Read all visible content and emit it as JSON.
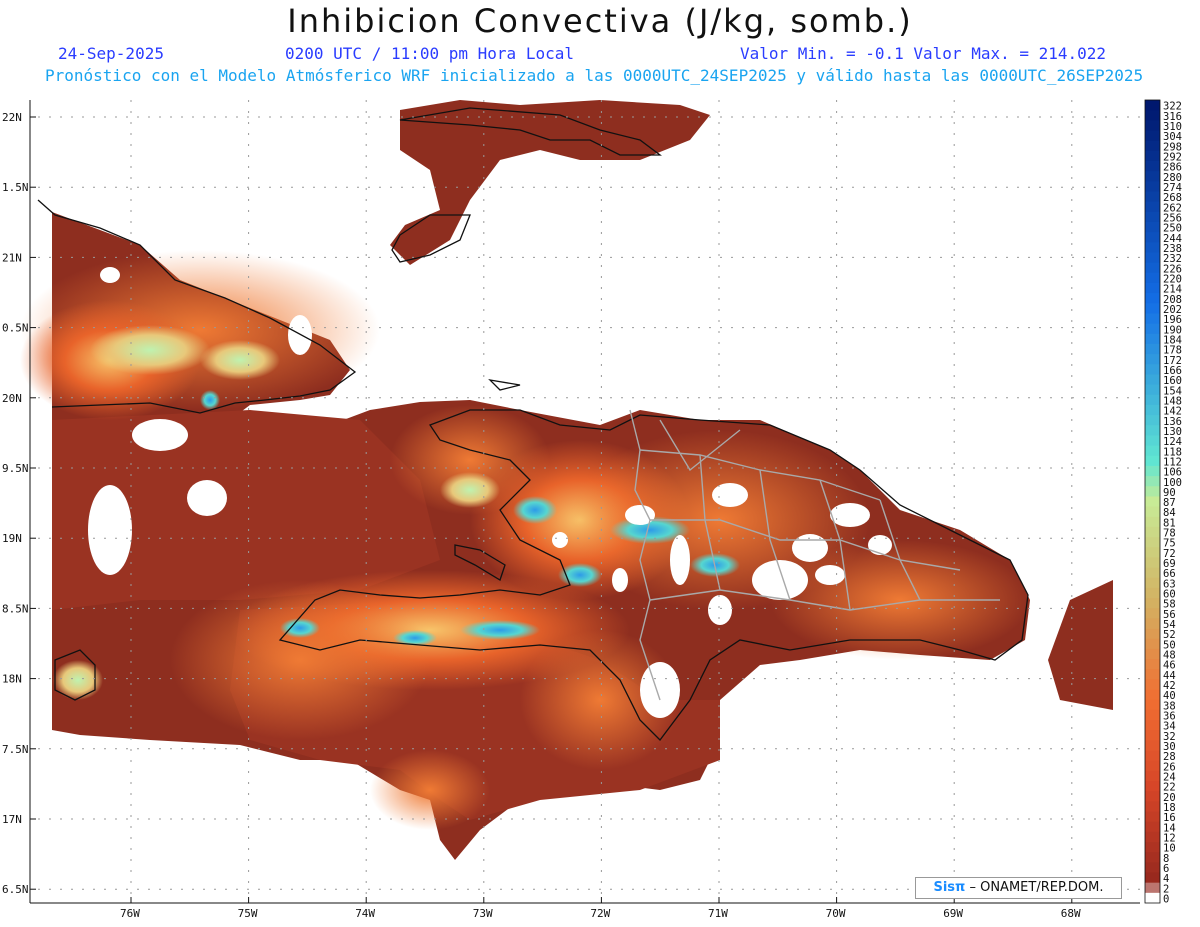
{
  "header": {
    "title": "Inhibicion Convectiva (J/kg, somb.)",
    "date": "24-Sep-2025",
    "time": "0200 UTC / 11:00 pm Hora Local",
    "min_max": "Valor Min. = -0.1  Valor Max. = 214.022",
    "model_line": "Pronóstico con el Modelo Atmósferico WRF inicializado a las 0000UTC_24SEP2025 y válido hasta las  0000UTC_26SEP2025"
  },
  "map": {
    "lat_labels": [
      "22N",
      "1.5N",
      "21N",
      "0.5N",
      "20N",
      "9.5N",
      "19N",
      "8.5N",
      "18N",
      "7.5N",
      "17N",
      "6.5N"
    ],
    "lon_labels": [
      "76W",
      "75W",
      "74W",
      "73W",
      "72W",
      "71W",
      "70W",
      "69W",
      "68W"
    ],
    "ocean_color": "#ffffff",
    "land_low_color": "#8b2a1c"
  },
  "colorbar": {
    "labels": [
      "322",
      "316",
      "310",
      "304",
      "298",
      "292",
      "286",
      "280",
      "274",
      "268",
      "262",
      "256",
      "250",
      "244",
      "238",
      "232",
      "226",
      "220",
      "214",
      "208",
      "202",
      "196",
      "190",
      "184",
      "178",
      "172",
      "166",
      "160",
      "154",
      "148",
      "142",
      "136",
      "130",
      "124",
      "118",
      "112",
      "106",
      "100",
      "90",
      "87",
      "84",
      "81",
      "78",
      "75",
      "72",
      "69",
      "66",
      "63",
      "60",
      "58",
      "56",
      "54",
      "52",
      "50",
      "48",
      "46",
      "44",
      "42",
      "40",
      "38",
      "36",
      "34",
      "32",
      "30",
      "28",
      "26",
      "24",
      "22",
      "20",
      "18",
      "16",
      "14",
      "12",
      "10",
      "8",
      "6",
      "4",
      "2",
      "0"
    ]
  },
  "credit": {
    "brand": "Sisπ",
    "text": "– ONAMET/REP.DOM."
  }
}
